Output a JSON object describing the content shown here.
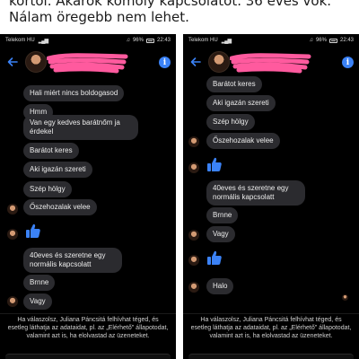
{
  "caption": {
    "line1": "körtöl. Akarok komoly kapcsolatot. 36 éves vok.",
    "line2": "Nálam öregebb nem lehet."
  },
  "left_phone": {
    "status": {
      "carrier": "Telekom HU",
      "battery": "96%",
      "time": "22:43"
    },
    "messages": [
      "Hali miért nincs boldogasod",
      "Hmm",
      "Van egy kedves barátnőm ja érdekel",
      "Barátot keres",
      "Aki igazán szereti",
      "Szép hölgy",
      "Őszehozalak velee",
      "40eves és szeretne egy normális kapcsolatt",
      "Brnne",
      "Vagy"
    ],
    "notice": "Ha válaszolsz, Juliana Páncsitá felhívhat téged, és esetleg láthatja az adataidat, pl. az „Elérhető\" állapotodat, valamint azt is, ha elolvastad az üzeneteket."
  },
  "right_phone": {
    "status": {
      "carrier": "Telekom HU",
      "battery": "96%",
      "time": "22:43"
    },
    "messages": [
      "Barátot keres",
      "Aki igazán szereti",
      "Szép hölgy",
      "Őszehozalak velee",
      "40eves és szeretne egy normális kapcsolatt",
      "Brnne",
      "Vagy",
      "Halo"
    ],
    "notice": "Ha válaszolsz, Juliana Páncsitá felhívhat téged, és esetleg láthatja az adataidat, pl. az „Elérhető\" állapotodat, valamint azt is, ha elolvastad az üzeneteket."
  },
  "colors": {
    "background": "#000000",
    "bubble": "#2b2b2f",
    "accent_blue": "#3b82f6",
    "scribble": "#ff5a9e"
  },
  "icons": [
    "back-arrow-icon",
    "info-icon",
    "thumbs-up-icon",
    "avatar"
  ]
}
